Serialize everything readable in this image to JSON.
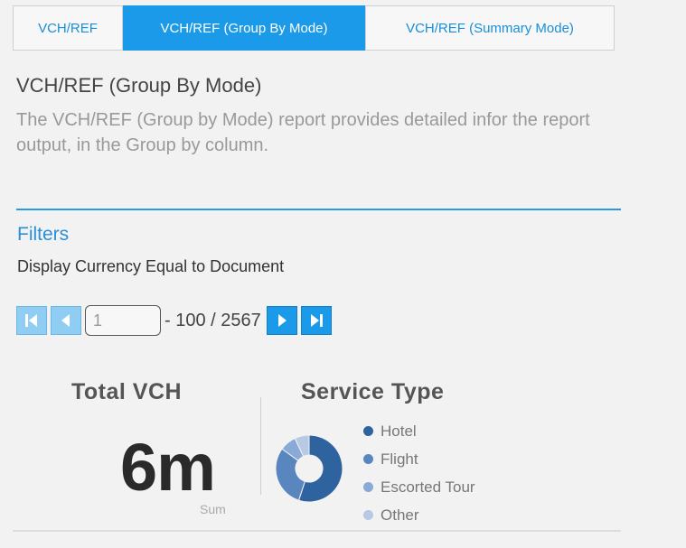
{
  "tabs": [
    {
      "label": "VCH/REF"
    },
    {
      "label": "VCH/REF (Group By Mode)"
    },
    {
      "label": "VCH/REF (Summary Mode)"
    }
  ],
  "report": {
    "title": "VCH/REF (Group By Mode)",
    "description": "The VCH/REF (Group by Mode) report provides detailed infor the report output, in the Group by column."
  },
  "filters": {
    "title": "Filters",
    "line": "Display Currency Equal to Document"
  },
  "pager": {
    "page_value": "1",
    "range_text": "- 100 / 2567"
  },
  "kpi": {
    "title": "Total VCH",
    "value": "6m",
    "sub": "Sum"
  },
  "service": {
    "title": "Service Type",
    "legend": [
      {
        "label": "Hotel",
        "color": "#2f63a0"
      },
      {
        "label": "Flight",
        "color": "#5a86bf"
      },
      {
        "label": "Escorted Tour",
        "color": "#89aad6"
      },
      {
        "label": "Other",
        "color": "#b7c9e3"
      }
    ]
  },
  "chart_data": {
    "type": "pie",
    "title": "Service Type",
    "categories": [
      "Hotel",
      "Flight",
      "Escorted Tour",
      "Other"
    ],
    "values": [
      55,
      30,
      8,
      7
    ],
    "colors": [
      "#2f63a0",
      "#5a86bf",
      "#89aad6",
      "#b7c9e3"
    ]
  }
}
